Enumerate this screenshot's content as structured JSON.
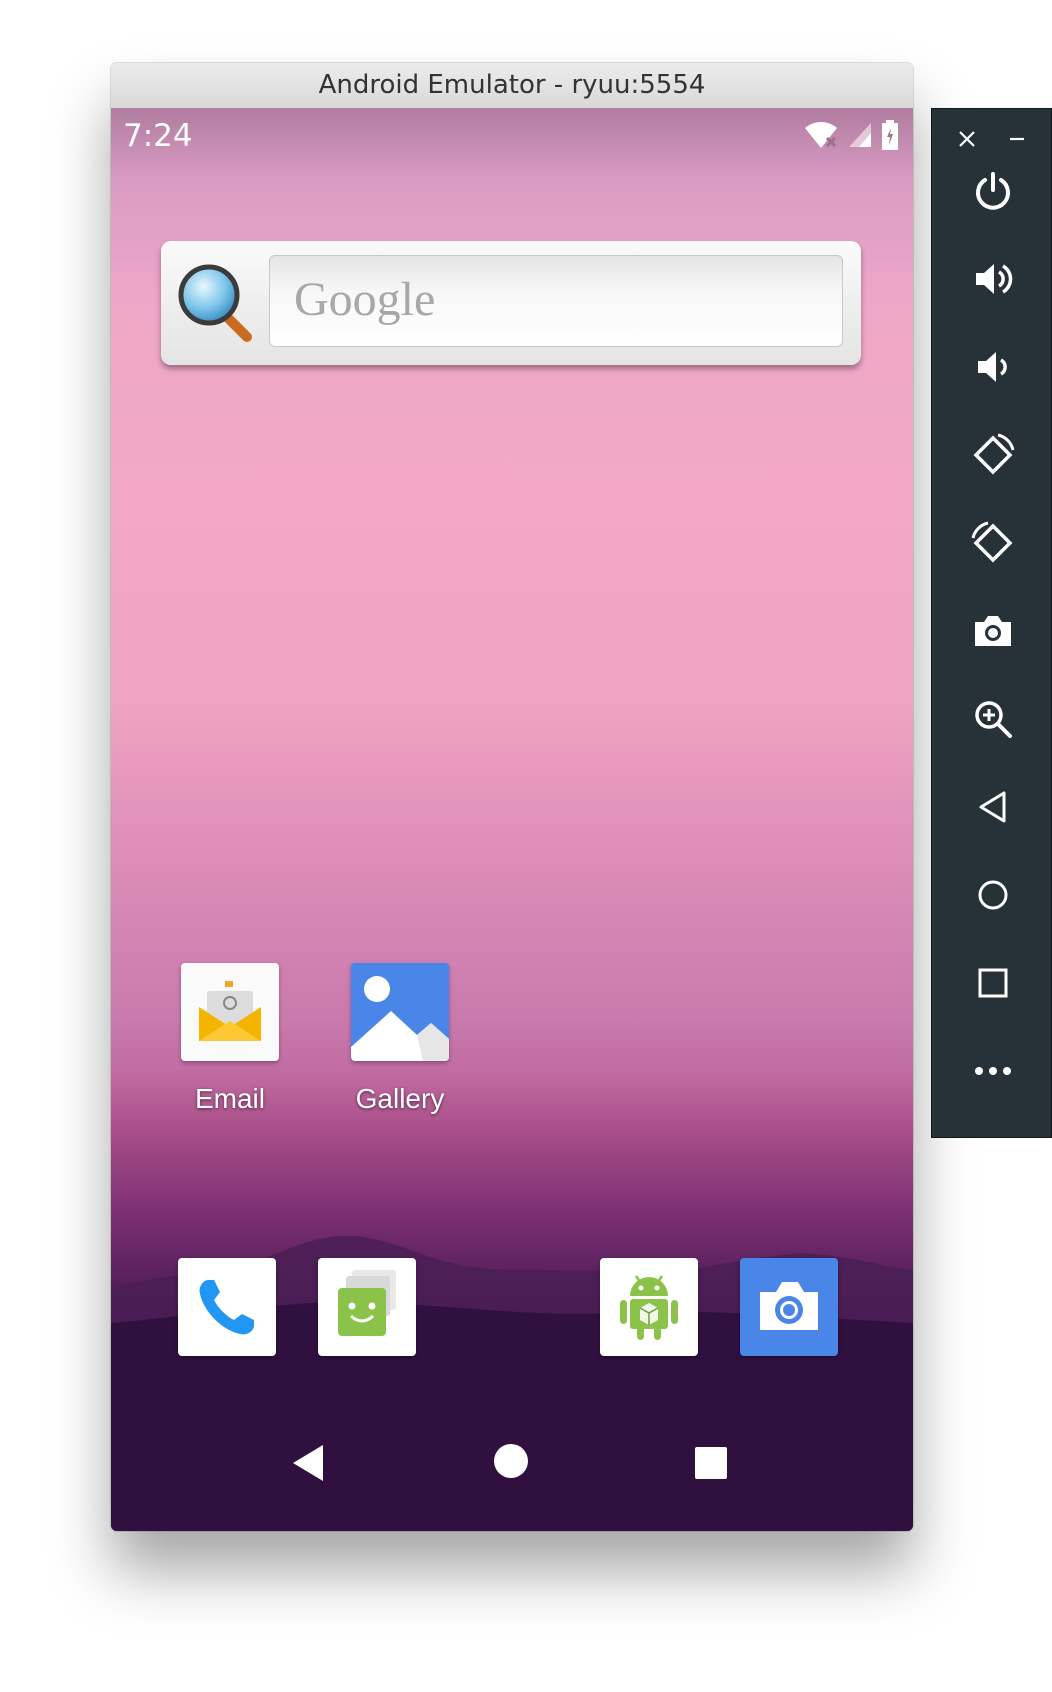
{
  "window": {
    "title": "Android Emulator - ryuu:5554"
  },
  "status_bar": {
    "time": "7:24",
    "icons": [
      "wifi-icon",
      "signal-icon",
      "battery-icon"
    ]
  },
  "search_widget": {
    "placeholder": "Google",
    "icon": "magnifier-icon"
  },
  "home_apps": [
    {
      "label": "Email",
      "icon": "email-icon"
    },
    {
      "label": "Gallery",
      "icon": "gallery-icon"
    }
  ],
  "dock_apps": [
    "phone-icon",
    "messages-icon",
    "android-app-icon",
    "camera-icon"
  ],
  "nav_buttons": [
    "back-icon",
    "home-icon",
    "recents-icon"
  ],
  "side_panel": {
    "buttons": [
      "close-icon",
      "minimize-icon",
      "power-icon",
      "volume-up-icon",
      "volume-down-icon",
      "rotate-left-icon",
      "rotate-right-icon",
      "screenshot-icon",
      "zoom-icon",
      "back-icon",
      "home-icon",
      "overview-icon",
      "more-icon"
    ]
  },
  "colors": {
    "panel_bg": "#263238",
    "camera_bg": "#4a86e8",
    "wallpaper_top": "#f2a8c6",
    "wallpaper_bottom": "#1f0830"
  }
}
